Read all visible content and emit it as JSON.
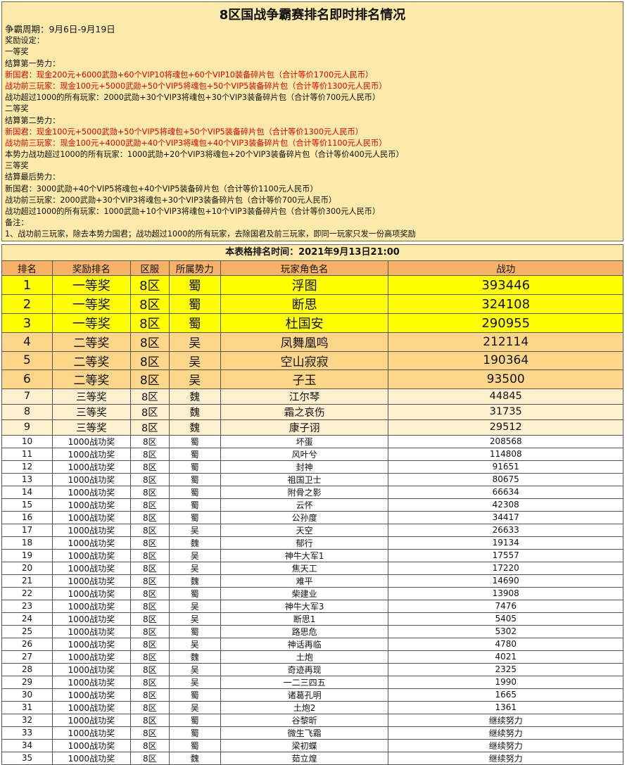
{
  "title": "8区国战争霸赛排名即时排名情况",
  "info_lines": [
    {
      "text": "争霸周期：9月6日-9月19日",
      "style": "big"
    },
    {
      "text": "奖励设定：",
      "style": ""
    },
    {
      "text": "一等奖",
      "style": ""
    },
    {
      "text": "结算第一势力：",
      "style": ""
    },
    {
      "text": "新国君：现金200元+6000武勋+60个VIP10将魂包+60个VIP10装备碎片包（合计等价1700元人民币）",
      "style": "red"
    },
    {
      "text": "战功前三玩家：现金100元+5000武勋+50个VIP5将魂包+50个VIP5装备碎片包（合计等价1300元人民币）",
      "style": "red"
    },
    {
      "text": "战功超过1000的所有玩家：2000武勋+30个VIP3将魂包+30个VIP3装备碎片包（合计等价700元人民币）",
      "style": ""
    },
    {
      "text": "二等奖",
      "style": ""
    },
    {
      "text": "结算第二势力：",
      "style": ""
    },
    {
      "text": "新国君：现金100元+5000武勋+50个VIP5将魂包+50个VIP5装备碎片包（合计等价1300元人民币）",
      "style": "red"
    },
    {
      "text": "战功前三玩家：现金100元+4000武勋+40个VIP3将魂包+40个VIP3装备碎片包（合计等价1100元人民币）",
      "style": "red"
    },
    {
      "text": "本势力战功超过1000的所有玩家：1000武勋+20个VIP3将魂包+20个VIP3装备碎片包（合计等价400元人民币）",
      "style": ""
    },
    {
      "text": "三等奖",
      "style": ""
    },
    {
      "text": "结算最后势力：",
      "style": ""
    },
    {
      "text": "新国君：3000武勋+40个VIP5将魂包+40个VIP5装备碎片包（合计等价1100元人民币）",
      "style": ""
    },
    {
      "text": "战功前三玩家：2000武勋+30个VIP3将魂包+30个VIP3装备碎片包（合计等价700元人民币）",
      "style": ""
    },
    {
      "text": "战功超过1000的所有玩家：1000武勋+10个VIP3将魂包+10个VIP3装备碎片包（合计等价300元人民币）",
      "style": ""
    },
    {
      "text": "备注：",
      "style": ""
    },
    {
      "text": "1、战功前三玩家，除去本势力国君；战功超过1000的所有玩家，去除国君及前三玩家，即同一玩家只发一份高项奖励",
      "style": ""
    }
  ],
  "time_bar": "本表格排名时间：2021年9月13日21:00",
  "table": {
    "headers": [
      "排名",
      "奖励排名",
      "区服",
      "所属势力",
      "玩家角色名",
      "战功"
    ],
    "rows": [
      {
        "rank": "1",
        "prize": "一等奖",
        "server": "8区",
        "faction": "蜀",
        "name": "浮图",
        "score": "393446",
        "tier": "tier1"
      },
      {
        "rank": "2",
        "prize": "一等奖",
        "server": "8区",
        "faction": "蜀",
        "name": "断思",
        "score": "324108",
        "tier": "tier1"
      },
      {
        "rank": "3",
        "prize": "一等奖",
        "server": "8区",
        "faction": "蜀",
        "name": "杜国安",
        "score": "290955",
        "tier": "tier1"
      },
      {
        "rank": "4",
        "prize": "二等奖",
        "server": "8区",
        "faction": "吴",
        "name": "凤舞凰鸣",
        "score": "212114",
        "tier": "tier2"
      },
      {
        "rank": "5",
        "prize": "二等奖",
        "server": "8区",
        "faction": "吴",
        "name": "空山寂寂",
        "score": "190364",
        "tier": "tier2"
      },
      {
        "rank": "6",
        "prize": "二等奖",
        "server": "8区",
        "faction": "吴",
        "name": "子玉",
        "score": "93500",
        "tier": "tier2"
      },
      {
        "rank": "7",
        "prize": "三等奖",
        "server": "8区",
        "faction": "魏",
        "name": "江尔琴",
        "score": "44845",
        "tier": "tier3"
      },
      {
        "rank": "8",
        "prize": "三等奖",
        "server": "8区",
        "faction": "魏",
        "name": "霜之哀伤",
        "score": "31735",
        "tier": "tier3"
      },
      {
        "rank": "9",
        "prize": "三等奖",
        "server": "8区",
        "faction": "魏",
        "name": "康子诩",
        "score": "29512",
        "tier": "tier3"
      },
      {
        "rank": "10",
        "prize": "1000战功奖",
        "server": "8区",
        "faction": "蜀",
        "name": "坏蛋",
        "score": "208568",
        "tier": "norm"
      },
      {
        "rank": "11",
        "prize": "1000战功奖",
        "server": "8区",
        "faction": "蜀",
        "name": "风叶兮",
        "score": "114808",
        "tier": "norm"
      },
      {
        "rank": "12",
        "prize": "1000战功奖",
        "server": "8区",
        "faction": "蜀",
        "name": "封神",
        "score": "91651",
        "tier": "norm"
      },
      {
        "rank": "13",
        "prize": "1000战功奖",
        "server": "8区",
        "faction": "蜀",
        "name": "祖国卫士",
        "score": "80675",
        "tier": "norm"
      },
      {
        "rank": "14",
        "prize": "1000战功奖",
        "server": "8区",
        "faction": "蜀",
        "name": "附骨之影",
        "score": "66634",
        "tier": "norm"
      },
      {
        "rank": "15",
        "prize": "1000战功奖",
        "server": "8区",
        "faction": "蜀",
        "name": "云怀",
        "score": "42308",
        "tier": "norm"
      },
      {
        "rank": "16",
        "prize": "1000战功奖",
        "server": "8区",
        "faction": "蜀",
        "name": "公孙度",
        "score": "34417",
        "tier": "norm"
      },
      {
        "rank": "17",
        "prize": "1000战功奖",
        "server": "8区",
        "faction": "吴",
        "name": "天空",
        "score": "26633",
        "tier": "norm"
      },
      {
        "rank": "18",
        "prize": "1000战功奖",
        "server": "8区",
        "faction": "魏",
        "name": "郁行",
        "score": "19134",
        "tier": "norm"
      },
      {
        "rank": "19",
        "prize": "1000战功奖",
        "server": "8区",
        "faction": "吴",
        "name": "神牛大军1",
        "score": "17557",
        "tier": "norm"
      },
      {
        "rank": "20",
        "prize": "1000战功奖",
        "server": "8区",
        "faction": "吴",
        "name": "焦天工",
        "score": "17220",
        "tier": "norm"
      },
      {
        "rank": "21",
        "prize": "1000战功奖",
        "server": "8区",
        "faction": "魏",
        "name": "难平",
        "score": "14690",
        "tier": "norm"
      },
      {
        "rank": "22",
        "prize": "1000战功奖",
        "server": "8区",
        "faction": "蜀",
        "name": "柴建业",
        "score": "13908",
        "tier": "norm"
      },
      {
        "rank": "23",
        "prize": "1000战功奖",
        "server": "8区",
        "faction": "吴",
        "name": "神牛大军3",
        "score": "7476",
        "tier": "norm"
      },
      {
        "rank": "24",
        "prize": "1000战功奖",
        "server": "8区",
        "faction": "吴",
        "name": "断思1",
        "score": "5405",
        "tier": "norm"
      },
      {
        "rank": "25",
        "prize": "1000战功奖",
        "server": "8区",
        "faction": "蜀",
        "name": "路思危",
        "score": "5302",
        "tier": "norm"
      },
      {
        "rank": "26",
        "prize": "1000战功奖",
        "server": "8区",
        "faction": "吴",
        "name": "神话再临",
        "score": "4780",
        "tier": "norm"
      },
      {
        "rank": "27",
        "prize": "1000战功奖",
        "server": "8区",
        "faction": "魏",
        "name": "土炮",
        "score": "4021",
        "tier": "norm"
      },
      {
        "rank": "28",
        "prize": "1000战功奖",
        "server": "8区",
        "faction": "吴",
        "name": "奇迹再现",
        "score": "2325",
        "tier": "norm"
      },
      {
        "rank": "29",
        "prize": "1000战功奖",
        "server": "8区",
        "faction": "吴",
        "name": "一二三四五",
        "score": "1990",
        "tier": "norm"
      },
      {
        "rank": "30",
        "prize": "1000战功奖",
        "server": "8区",
        "faction": "蜀",
        "name": "诸葛孔明",
        "score": "1665",
        "tier": "norm"
      },
      {
        "rank": "31",
        "prize": "1000战功奖",
        "server": "8区",
        "faction": "吴",
        "name": "土炮2",
        "score": "1361",
        "tier": "norm"
      },
      {
        "rank": "32",
        "prize": "1000战功奖",
        "server": "8区",
        "faction": "蜀",
        "name": "谷黎昕",
        "score": "继续努力",
        "tier": "norm"
      },
      {
        "rank": "33",
        "prize": "1000战功奖",
        "server": "8区",
        "faction": "蜀",
        "name": "微生飞霜",
        "score": "继续努力",
        "tier": "norm"
      },
      {
        "rank": "34",
        "prize": "1000战功奖",
        "server": "8区",
        "faction": "蜀",
        "name": "梁初蝶",
        "score": "继续努力",
        "tier": "norm"
      },
      {
        "rank": "35",
        "prize": "1000战功奖",
        "server": "8区",
        "faction": "魏",
        "name": "茹立煌",
        "score": "继续努力",
        "tier": "norm"
      }
    ]
  }
}
